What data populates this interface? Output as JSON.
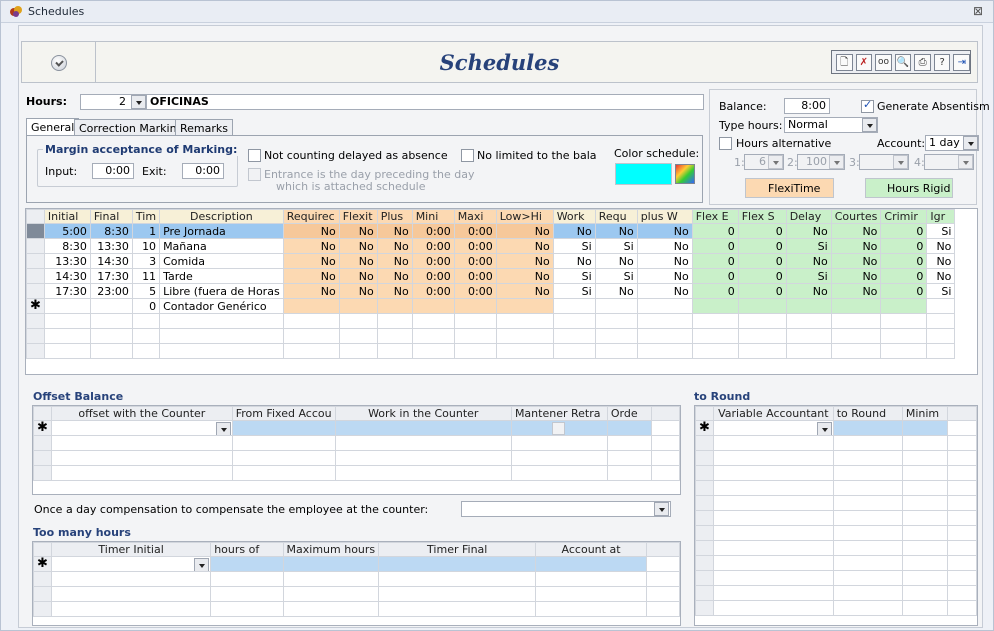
{
  "window": {
    "title": "Schedules",
    "close_glyph": "⊠"
  },
  "header": {
    "title": "Schedules",
    "toolbar_icons": [
      "new-icon",
      "delete-icon",
      "glasses-icon",
      "preview-icon",
      "print-icon",
      "help-icon",
      "exit-icon"
    ]
  },
  "hours": {
    "label": "Hours:",
    "number": "2",
    "name": "OFICINAS"
  },
  "tabs": [
    "General",
    "Correction Marking",
    "Remarks"
  ],
  "general": {
    "margin_title": "Margin acceptance of Marking:",
    "input_label": "Input:",
    "input_value": "0:00",
    "exit_label": "Exit:",
    "exit_value": "0:00",
    "not_counting_label": "Not counting delayed as absence",
    "entrance_label_1": "Entrance is the day preceding the day",
    "entrance_label_2": "which is attached schedule",
    "no_limited_label": "No limited to the bala",
    "color_schedule_label": "Color schedule:",
    "color_schedule_value": "#00ffff"
  },
  "right_panel": {
    "balance_label": "Balance:",
    "balance_value": "8:00",
    "generate_absentism_label": "Generate Absentism",
    "type_hours_label": "Type hours:",
    "type_hours_value": "Normal",
    "hours_alternative_label": "Hours alternative",
    "account_label": "Account:",
    "account_value": "1 day",
    "alt_1_label": "1:",
    "alt_1_value": "6",
    "alt_2_label": "2:",
    "alt_2_value": "100",
    "alt_3_label": "3:",
    "alt_4_label": "4:",
    "flexitime_label": "FlexiTime",
    "hours_rigid_label": "Hours Rigid",
    "flexitime_color": "#fcd9b2",
    "hours_rigid_color": "#c9f0c9"
  },
  "main_grid": {
    "columns": [
      "Initial",
      "Final",
      "Tim",
      "Description",
      "Requirec",
      "Flexit",
      "Plus",
      "Mini",
      "Maxi",
      "Low>Hi",
      "Work",
      "Requ",
      "plus W",
      "Flex E",
      "Flex S",
      "Delay",
      "Courtes",
      "Crimir",
      "Igr"
    ],
    "rows": [
      [
        "5:00",
        "8:30",
        "1",
        "Pre Jornada",
        "No",
        "No",
        "No",
        "0:00",
        "0:00",
        "No",
        "No",
        "No",
        "No",
        "0",
        "0",
        "No",
        "No",
        "0",
        "Si"
      ],
      [
        "8:30",
        "13:30",
        "10",
        "Mañana",
        "No",
        "No",
        "No",
        "0:00",
        "0:00",
        "No",
        "Si",
        "Si",
        "No",
        "0",
        "0",
        "Si",
        "No",
        "0",
        "No"
      ],
      [
        "13:30",
        "14:30",
        "3",
        "Comida",
        "No",
        "No",
        "No",
        "0:00",
        "0:00",
        "No",
        "No",
        "No",
        "No",
        "0",
        "0",
        "No",
        "No",
        "0",
        "No"
      ],
      [
        "14:30",
        "17:30",
        "11",
        "Tarde",
        "No",
        "No",
        "No",
        "0:00",
        "0:00",
        "No",
        "Si",
        "Si",
        "No",
        "0",
        "0",
        "Si",
        "No",
        "0",
        "No"
      ],
      [
        "17:30",
        "23:00",
        "5",
        "Libre (fuera de Horas",
        "No",
        "No",
        "No",
        "0:00",
        "0:00",
        "No",
        "Si",
        "No",
        "No",
        "0",
        "0",
        "No",
        "No",
        "0",
        "Si"
      ]
    ],
    "new_row": {
      "marker": "✱",
      "tim": "0",
      "description": "Contador Genérico"
    }
  },
  "offset_balance": {
    "title": "Offset Balance",
    "columns": [
      "offset with the Counter",
      "From Fixed Accou",
      "Work in the Counter",
      "Mantener Retra",
      "Orde"
    ],
    "compensation_label": "Once a day compensation to compensate the employee at the counter:"
  },
  "too_many_hours": {
    "title": "Too many hours",
    "columns": [
      "Timer Initial",
      "hours of",
      "Maximum hours",
      "Timer Final",
      "Account at"
    ]
  },
  "to_round": {
    "title": "to Round",
    "columns": [
      "Variable Accountant",
      "to Round",
      "Minim"
    ]
  }
}
